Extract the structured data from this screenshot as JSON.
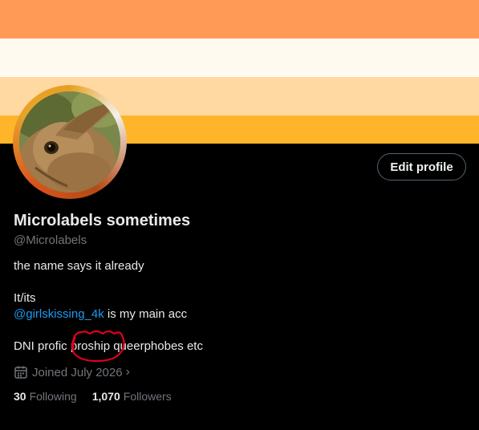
{
  "banner": {
    "stripe_colors": [
      "#ff9a56",
      "#ffa969",
      "#fffaf0",
      "#ffd8a2",
      "#ffb52a",
      "#000000"
    ]
  },
  "profile": {
    "display_name": "Microlabels sometimes",
    "handle": "@Microlabels",
    "edit_button_label": "Edit profile",
    "bio": {
      "line1": "the name says it already",
      "line2": "It/its",
      "mention": "@girlskissing_4k",
      "line3_suffix": " is my main acc",
      "line4": "DNI profic proship queerphobes etc"
    },
    "joined": "Joined July 2026",
    "following_count": "30",
    "following_label": "Following",
    "followers_count": "1,070",
    "followers_label": "Followers"
  },
  "icons": {
    "calendar": "calendar-icon",
    "chevron": "chevron-right-icon"
  },
  "colors": {
    "link": "#1d9bf0",
    "muted_text": "#71767b",
    "primary_text": "#e7e9ea",
    "scribble": "#e0001b"
  }
}
